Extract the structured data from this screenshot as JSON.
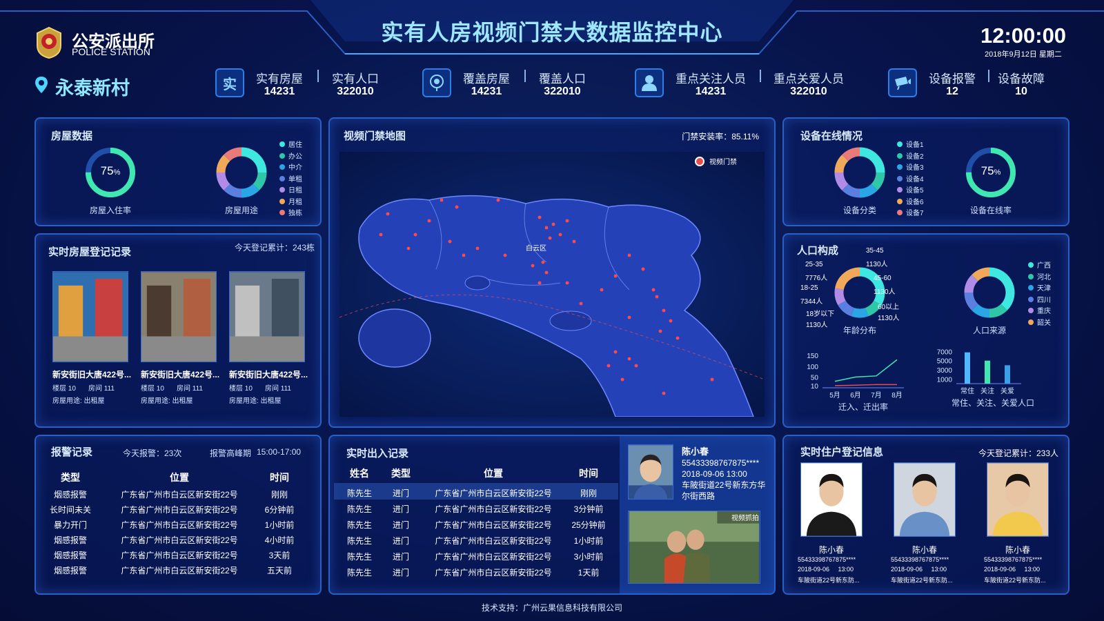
{
  "header": {
    "title": "实有人房视频门禁大数据监控中心",
    "logo_cn": "公安派出所",
    "logo_en": "POLICE STATION",
    "time": "12:00:00",
    "date": "2018年9月12日 星期二",
    "location": "永泰新村"
  },
  "stats": [
    {
      "icon": "实",
      "a_label": "实有房屋",
      "a_value": "14231",
      "b_label": "实有人口",
      "b_value": "322010"
    },
    {
      "icon": "map-pin-icon",
      "a_label": "覆盖房屋",
      "a_value": "14231",
      "b_label": "覆盖人口",
      "b_value": "322010"
    },
    {
      "icon": "person-icon",
      "a_label": "重点关注人员",
      "a_value": "14231",
      "b_label": "重点关爱人员",
      "b_value": "322010"
    },
    {
      "icon": "camera-icon",
      "a_label": "设备报警",
      "a_value": "12",
      "b_label": "设备故障",
      "b_value": "10"
    }
  ],
  "house_data": {
    "title": "房屋数据",
    "occupancy": "75",
    "percent_sign": "%",
    "occupancy_label": "房屋入住率",
    "usage_label": "房屋用途",
    "legend": [
      "居住",
      "办公",
      "中介",
      "单租",
      "日租",
      "月租",
      "独栋"
    ],
    "colors": [
      "#3ee8e0",
      "#2ec8a8",
      "#2aa6e6",
      "#5a7fe0",
      "#b08ce6",
      "#f0a85a",
      "#e97a7a"
    ]
  },
  "map": {
    "title": "视频门禁地图",
    "rate_label": "门禁安装率：85.11%",
    "legend": "视频门禁",
    "district": "白云区"
  },
  "device": {
    "title": "设备在线情况",
    "class_label": "设备分类",
    "online_label": "设备在线率",
    "online": "75",
    "percent_sign": "%",
    "legend": [
      "设备1",
      "设备2",
      "设备3",
      "设备4",
      "设备5",
      "设备6",
      "设备7"
    ],
    "colors": [
      "#3ee8e0",
      "#2ec8a8",
      "#2aa6e6",
      "#5a7fe0",
      "#b08ce6",
      "#f0a85a",
      "#e97a7a"
    ]
  },
  "house_reg": {
    "title": "实时房屋登记记录",
    "count": "今天登记累计：243栋",
    "items": [
      {
        "name": "新安街旧大唐422号...",
        "floor": "楼层 10",
        "room": "房间 111",
        "use": "房屋用途: 出租屋"
      },
      {
        "name": "新安街旧大唐422号...",
        "floor": "楼层 10",
        "room": "房间 111",
        "use": "房屋用途: 出租屋"
      },
      {
        "name": "新安街旧大唐422号...",
        "floor": "楼层 10",
        "room": "房间 111",
        "use": "房屋用途: 出租屋"
      }
    ]
  },
  "population": {
    "title": "人口构成",
    "age_label": "年龄分布",
    "source_label": "人口来源",
    "age_labels": [
      "35-45",
      "1130人",
      "25-35",
      "7776人",
      "45-60",
      "1130人",
      "18-25",
      "7344人",
      "60以上",
      "1130人",
      "18岁以下",
      "1130人"
    ],
    "source_legend": [
      "广西",
      "河北",
      "天津",
      "四川",
      "重庆",
      "韶关"
    ],
    "colors": [
      "#3ee8e0",
      "#2ec8a8",
      "#2aa6e6",
      "#5a7fe0",
      "#b08ce6",
      "#f0a85a"
    ]
  },
  "chart_data": [
    {
      "type": "line",
      "title": "迁入、迁出率",
      "categories": [
        "5月",
        "6月",
        "7月",
        "8月"
      ],
      "yticks": [
        "150",
        "100",
        "50",
        "10"
      ],
      "ylim": [
        0,
        160
      ],
      "series": [
        {
          "values": [
            30,
            50,
            55,
            130
          ]
        },
        {
          "values": [
            10,
            12,
            15,
            15
          ]
        }
      ],
      "colors": [
        "#3ee8b0",
        "#e94c4c"
      ]
    },
    {
      "type": "bar",
      "title": "常住、关注、关爱人口",
      "categories": [
        "常住",
        "关注",
        "关爱"
      ],
      "yticks": [
        "7000",
        "5000",
        "3000",
        "1000"
      ],
      "ylim": [
        0,
        7500
      ],
      "values": [
        6800,
        5000,
        4000
      ],
      "colors": [
        "#4fb8ff",
        "#3ee8b0",
        "#3aa0e8"
      ]
    }
  ],
  "alarms": {
    "title": "报警记录",
    "today": "今天报警：23次",
    "peak_label": "报警高峰期",
    "peak": "15:00-17:00",
    "headers": [
      "类型",
      "位置",
      "时间"
    ],
    "rows": [
      [
        "烟感报警",
        "广东省广州市白云区新安街22号",
        "刚刚"
      ],
      [
        "长时间未关",
        "广东省广州市白云区新安街22号",
        "6分钟前"
      ],
      [
        "暴力开门",
        "广东省广州市白云区新安街22号",
        "1小时前"
      ],
      [
        "烟感报警",
        "广东省广州市白云区新安街22号",
        "4小时前"
      ],
      [
        "烟感报警",
        "广东省广州市白云区新安街22号",
        "3天前"
      ],
      [
        "烟感报警",
        "广东省广州市白云区新安街22号",
        "五天前"
      ]
    ]
  },
  "access": {
    "title": "实时出入记录",
    "headers": [
      "姓名",
      "类型",
      "位置",
      "时间"
    ],
    "rows": [
      [
        "陈先生",
        "进门",
        "广东省广州市白云区新安街22号",
        "刚刚"
      ],
      [
        "陈先生",
        "进门",
        "广东省广州市白云区新安街22号",
        "3分钟前"
      ],
      [
        "陈先生",
        "进门",
        "广东省广州市白云区新安街22号",
        "25分钟前"
      ],
      [
        "陈先生",
        "进门",
        "广东省广州市白云区新安街22号",
        "1小时前"
      ],
      [
        "陈先生",
        "进门",
        "广东省广州市白云区新安街22号",
        "3小时前"
      ],
      [
        "陈先生",
        "进门",
        "广东省广州市白云区新安街22号",
        "1天前"
      ]
    ],
    "person": {
      "name": "陈小春",
      "id": "55433398767875****",
      "time": "2018-09-06  13:00",
      "addr1": "车陂街道22号新东方华",
      "addr2": "尔街西路"
    },
    "capture": "视频抓拍"
  },
  "residents": {
    "title": "实时住户登记信息",
    "count": "今天登记累计：233人",
    "items": [
      {
        "name": "陈小春",
        "id": "55433398767875****",
        "time": "2018-09-06     13:00",
        "addr": "车陂街道22号新东防..."
      },
      {
        "name": "陈小春",
        "id": "55433398767875****",
        "time": "2018-09-06     13:00",
        "addr": "车陂街道22号新东防..."
      },
      {
        "name": "陈小春",
        "id": "55433398767875****",
        "time": "2018-09-06     13:00",
        "addr": "车陂街道22号新东防..."
      }
    ]
  },
  "footer": "技术支持：广州云果信息科技有限公司"
}
